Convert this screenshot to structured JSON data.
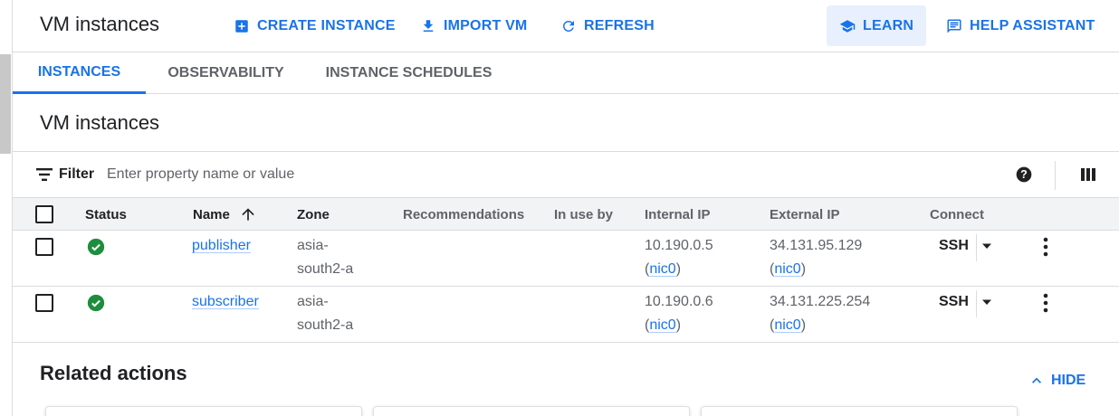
{
  "header": {
    "title": "VM instances",
    "create_label": "CREATE INSTANCE",
    "import_label": "IMPORT VM",
    "refresh_label": "REFRESH",
    "learn_label": "LEARN",
    "help_label": "HELP ASSISTANT"
  },
  "tabs": [
    {
      "label": "INSTANCES",
      "active": true
    },
    {
      "label": "OBSERVABILITY",
      "active": false
    },
    {
      "label": "INSTANCE SCHEDULES",
      "active": false
    }
  ],
  "section_title": "VM instances",
  "filter": {
    "label": "Filter",
    "placeholder": "Enter property name or value"
  },
  "table": {
    "columns": [
      "Status",
      "Name",
      "Zone",
      "Recommendations",
      "In use by",
      "Internal IP",
      "External IP",
      "Connect"
    ],
    "sorted_by": "Name",
    "rows": [
      {
        "name": "publisher",
        "zone_line1": "asia-",
        "zone_line2": "south2-a",
        "internal_ip": "10.190.0.5",
        "internal_nic": "nic0",
        "external_ip": "34.131.95.129",
        "external_nic": "nic0",
        "connect": "SSH",
        "status": "running"
      },
      {
        "name": "subscriber",
        "zone_line1": "asia-",
        "zone_line2": "south2-a",
        "internal_ip": "10.190.0.6",
        "internal_nic": "nic0",
        "external_ip": "34.131.225.254",
        "external_nic": "nic0",
        "connect": "SSH",
        "status": "running"
      }
    ]
  },
  "related": {
    "title": "Related actions",
    "hide_label": "HIDE"
  },
  "colors": {
    "accent": "#1a73e8",
    "status_ok": "#1e8e3e",
    "learn_bg": "#e8f0fe"
  }
}
